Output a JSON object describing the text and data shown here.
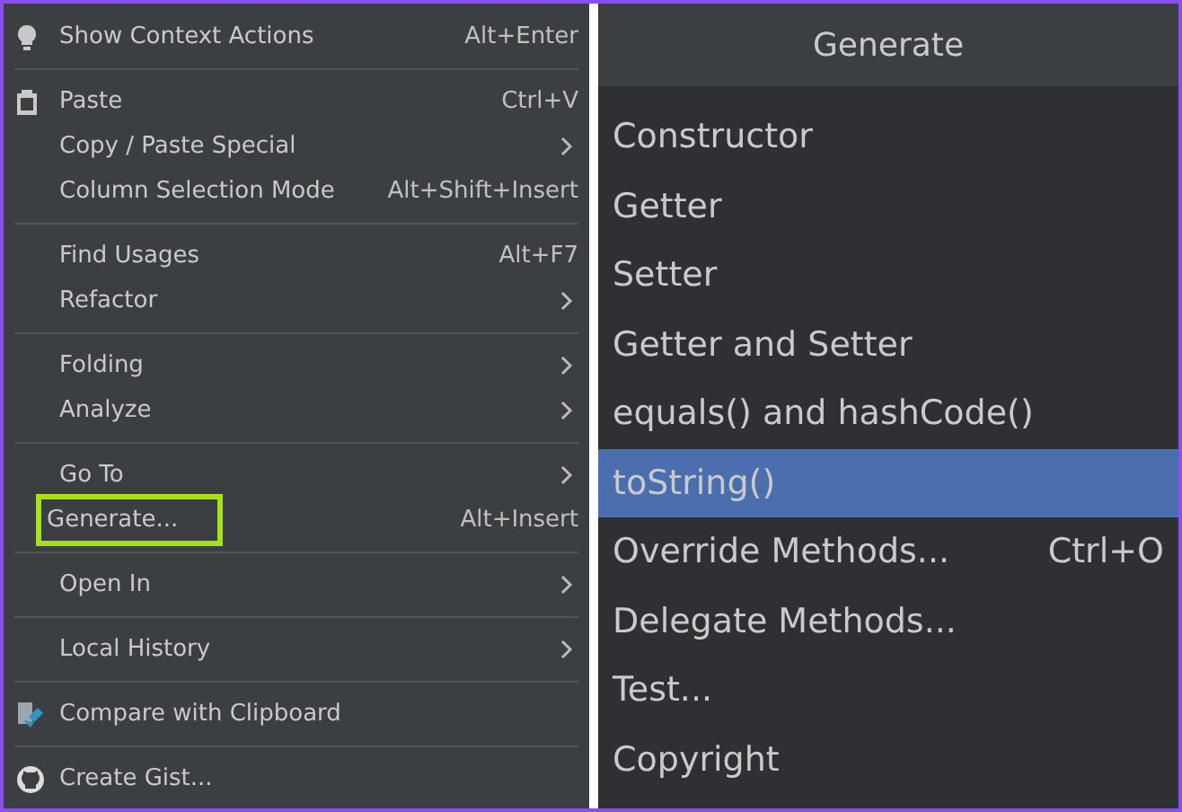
{
  "context_menu": {
    "groups": [
      {
        "items": [
          {
            "label": "Show Context Actions",
            "shortcut": "Alt+Enter",
            "kind": "bulb",
            "submenu": false,
            "highlighted": false
          }
        ]
      },
      {
        "items": [
          {
            "label": "Paste",
            "shortcut": "Ctrl+V",
            "kind": "clipboard",
            "submenu": false,
            "highlighted": false
          },
          {
            "label": "Copy / Paste Special",
            "submenu": true,
            "highlighted": false
          },
          {
            "label": "Column Selection Mode",
            "shortcut": "Alt+Shift+Insert",
            "submenu": false,
            "highlighted": false
          }
        ]
      },
      {
        "items": [
          {
            "label": "Find Usages",
            "shortcut": "Alt+F7",
            "submenu": false,
            "highlighted": false
          },
          {
            "label": "Refactor",
            "submenu": true,
            "highlighted": false
          }
        ]
      },
      {
        "items": [
          {
            "label": "Folding",
            "submenu": true,
            "highlighted": false
          },
          {
            "label": "Analyze",
            "submenu": true,
            "highlighted": false
          }
        ]
      },
      {
        "items": [
          {
            "label": "Go To",
            "submenu": true,
            "highlighted": false
          },
          {
            "label": "Generate...",
            "shortcut": "Alt+Insert",
            "submenu": false,
            "highlighted": true
          }
        ]
      },
      {
        "items": [
          {
            "label": "Open In",
            "submenu": true,
            "highlighted": false
          }
        ]
      },
      {
        "items": [
          {
            "label": "Local History",
            "submenu": true,
            "highlighted": false
          }
        ]
      },
      {
        "items": [
          {
            "label": "Compare with Clipboard",
            "kind": "compare",
            "submenu": false,
            "highlighted": false
          }
        ]
      },
      {
        "items": [
          {
            "label": "Create Gist...",
            "kind": "github",
            "submenu": false,
            "highlighted": false
          }
        ]
      }
    ]
  },
  "generate_popup": {
    "title": "Generate",
    "items": [
      {
        "label": "Constructor",
        "selected": false
      },
      {
        "label": "Getter",
        "selected": false
      },
      {
        "label": "Setter",
        "selected": false
      },
      {
        "label": "Getter and Setter",
        "selected": false
      },
      {
        "label": "equals() and hashCode()",
        "selected": false
      },
      {
        "label": "toString()",
        "selected": true
      },
      {
        "label": "Override Methods...",
        "shortcut": "Ctrl+O",
        "selected": false
      },
      {
        "label": "Delegate Methods...",
        "selected": false
      },
      {
        "label": "Test...",
        "selected": false
      },
      {
        "label": "Copyright",
        "selected": false
      }
    ]
  }
}
